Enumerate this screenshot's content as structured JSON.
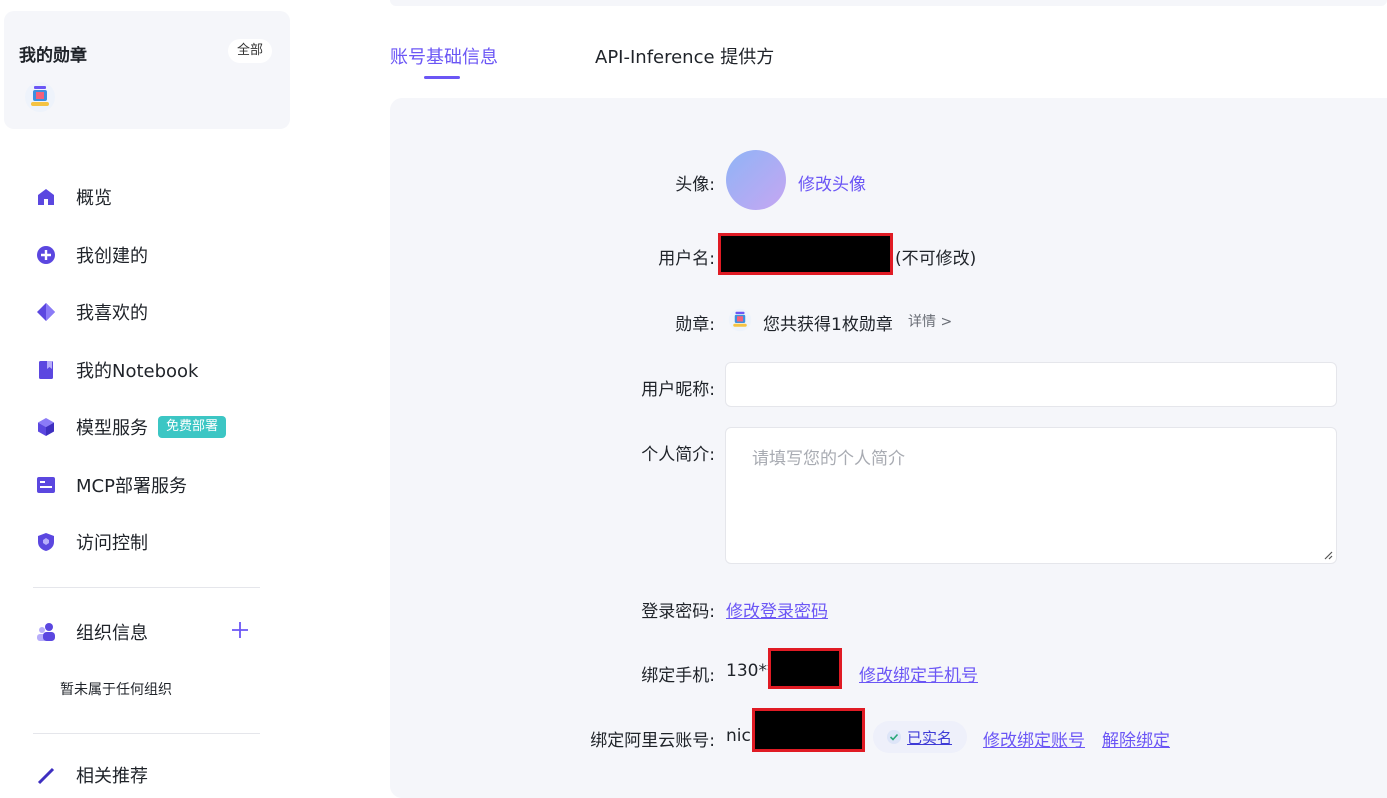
{
  "badges": {
    "title": "我的勋章",
    "all_label": "全部"
  },
  "nav": {
    "items": [
      {
        "label": "概览"
      },
      {
        "label": "我创建的"
      },
      {
        "label": "我喜欢的"
      },
      {
        "label": "我的Notebook"
      },
      {
        "label": "模型服务",
        "tag": "免费部署"
      },
      {
        "label": "MCP部署服务"
      },
      {
        "label": "访问控制"
      }
    ],
    "org": {
      "label": "组织信息",
      "empty": "暂未属于任何组织"
    },
    "partial_next": "相关推荐"
  },
  "tabs": [
    {
      "label": "账号基础信息",
      "active": true
    },
    {
      "label": "API-Inference 提供方",
      "active": false
    }
  ],
  "form": {
    "avatar_label": "头像:",
    "avatar_change": "修改头像",
    "username_label": "用户名:",
    "username_note": "(不可修改)",
    "medal_label": "勋章:",
    "medal_text": "您共获得1枚勋章",
    "medal_detail": "详情 >",
    "nickname_label": "用户昵称:",
    "nickname_value": "",
    "bio_label": "个人简介:",
    "bio_placeholder": "请填写您的个人简介",
    "password_label": "登录密码:",
    "password_change": "修改登录密码",
    "phone_label": "绑定手机:",
    "phone_prefix": "130**",
    "phone_change": "修改绑定手机号",
    "aliyun_label": "绑定阿里云账号:",
    "aliyun_prefix": "nick",
    "verified_label": "已实名",
    "aliyun_change": "修改绑定账号",
    "aliyun_unbind": "解除绑定"
  },
  "colors": {
    "accent": "#6b56f5",
    "tag": "#3cc6c4",
    "panel": "#f5f6fa",
    "redact_border": "#e01b24"
  }
}
